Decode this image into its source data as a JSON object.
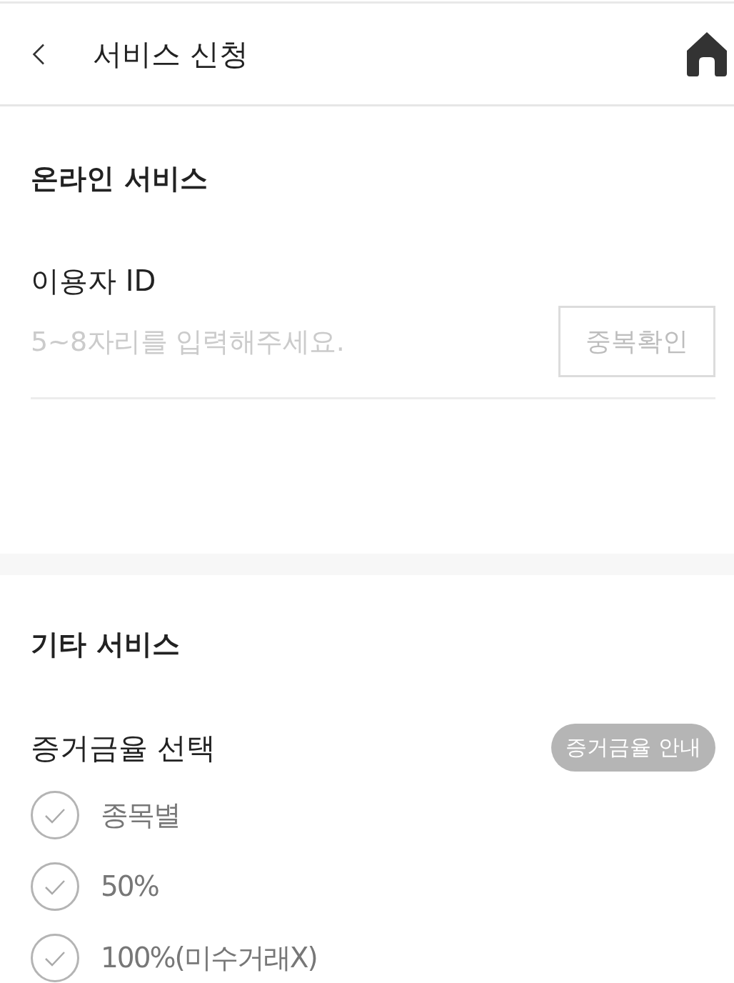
{
  "header": {
    "title": "서비스 신청"
  },
  "online_service": {
    "title": "온라인 서비스",
    "user_id": {
      "label": "이용자 ID",
      "placeholder": "5~8자리를 입력해주세요.",
      "check_button": "중복확인"
    }
  },
  "other_service": {
    "title": "기타 서비스",
    "margin_rate": {
      "label": "증거금율 선택",
      "info_button": "증거금율 안내",
      "options": [
        {
          "label": "종목별",
          "selected": false
        },
        {
          "label": "50%",
          "selected": false
        },
        {
          "label": "100%(미수거래X)",
          "selected": false
        }
      ]
    }
  }
}
